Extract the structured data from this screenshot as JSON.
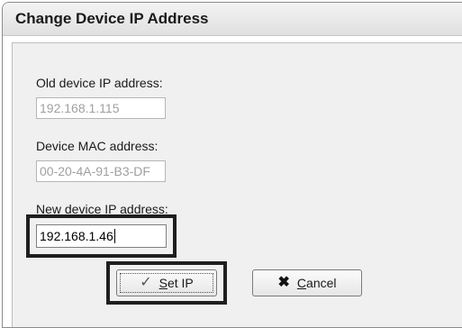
{
  "window": {
    "title": "Change Device IP Address"
  },
  "old_ip": {
    "label": "Old device IP address:",
    "value": "192.168.1.115"
  },
  "mac": {
    "label": "Device MAC address:",
    "value": "00-20-4A-91-B3-DF"
  },
  "new_ip": {
    "label": "New device IP address:",
    "value": "192.168.1.46"
  },
  "buttons": {
    "set_ip": {
      "mnemonic": "S",
      "rest": "et IP",
      "icon": "checkmark-icon"
    },
    "cancel": {
      "mnemonic": "C",
      "rest": "ancel",
      "icon": "x-icon"
    }
  }
}
